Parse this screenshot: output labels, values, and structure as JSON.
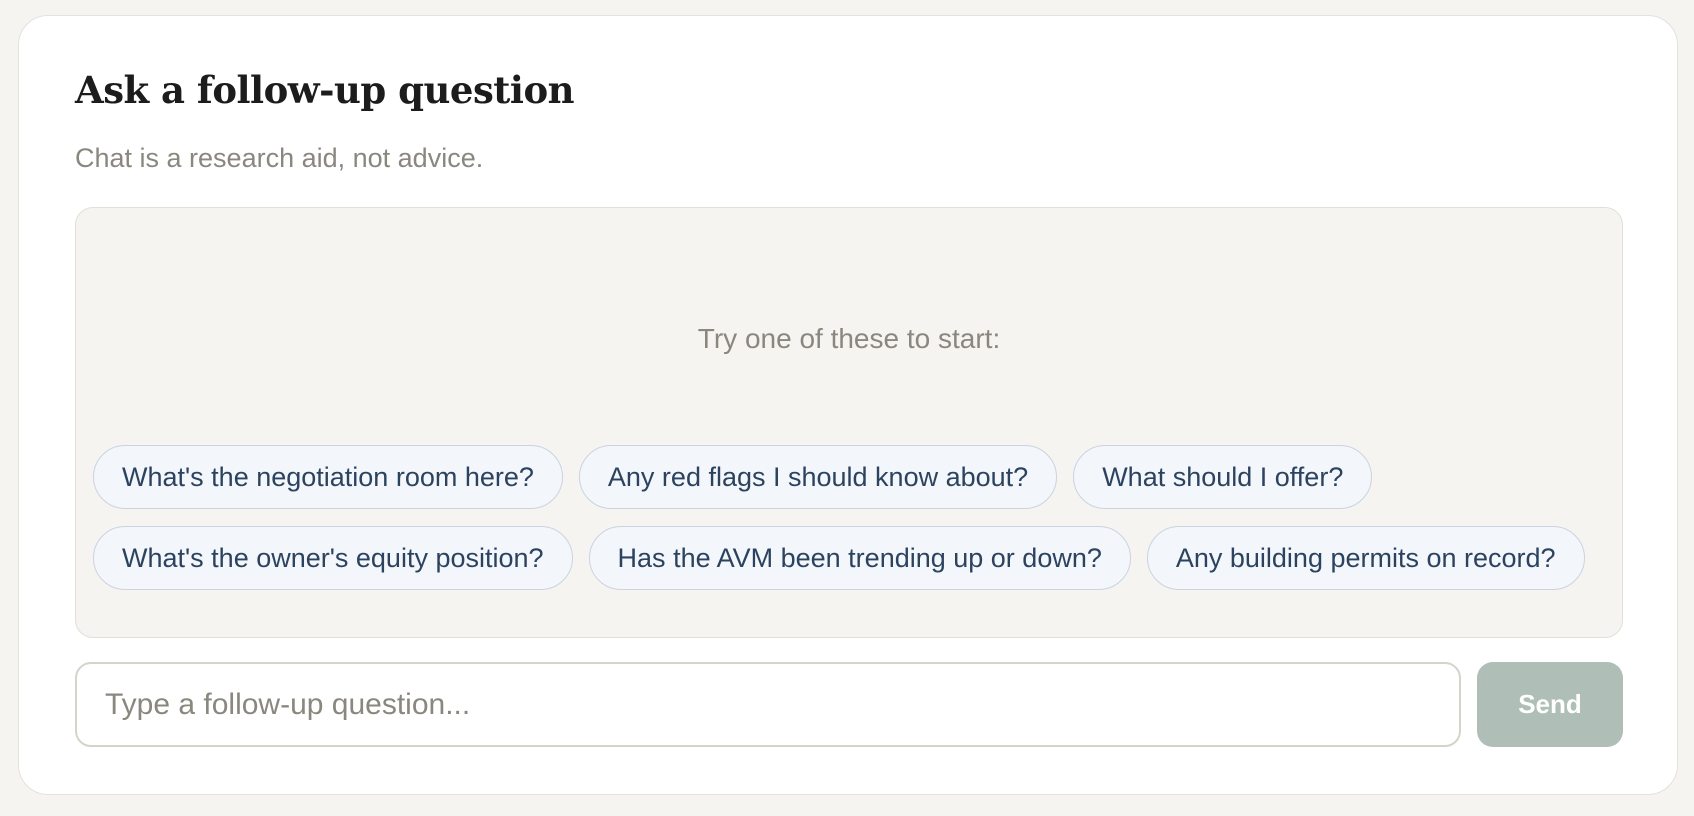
{
  "header": {
    "title": "Ask a follow-up question",
    "subtitle": "Chat is a research aid, not advice."
  },
  "suggestions": {
    "hint": "Try one of these to start:",
    "chips": [
      "What's the negotiation room here?",
      "Any red flags I should know about?",
      "What should I offer?",
      "What's the owner's equity position?",
      "Has the AVM been trending up or down?",
      "Any building permits on record?"
    ]
  },
  "composer": {
    "placeholder": "Type a follow-up question...",
    "value": "",
    "send_label": "Send"
  },
  "colors": {
    "page_background": "#f5f4f0",
    "card_background": "#ffffff",
    "chip_text": "#2c4360",
    "chip_background": "#f3f6fa",
    "send_button": "#afbfb7",
    "muted_text": "#8a877f"
  }
}
